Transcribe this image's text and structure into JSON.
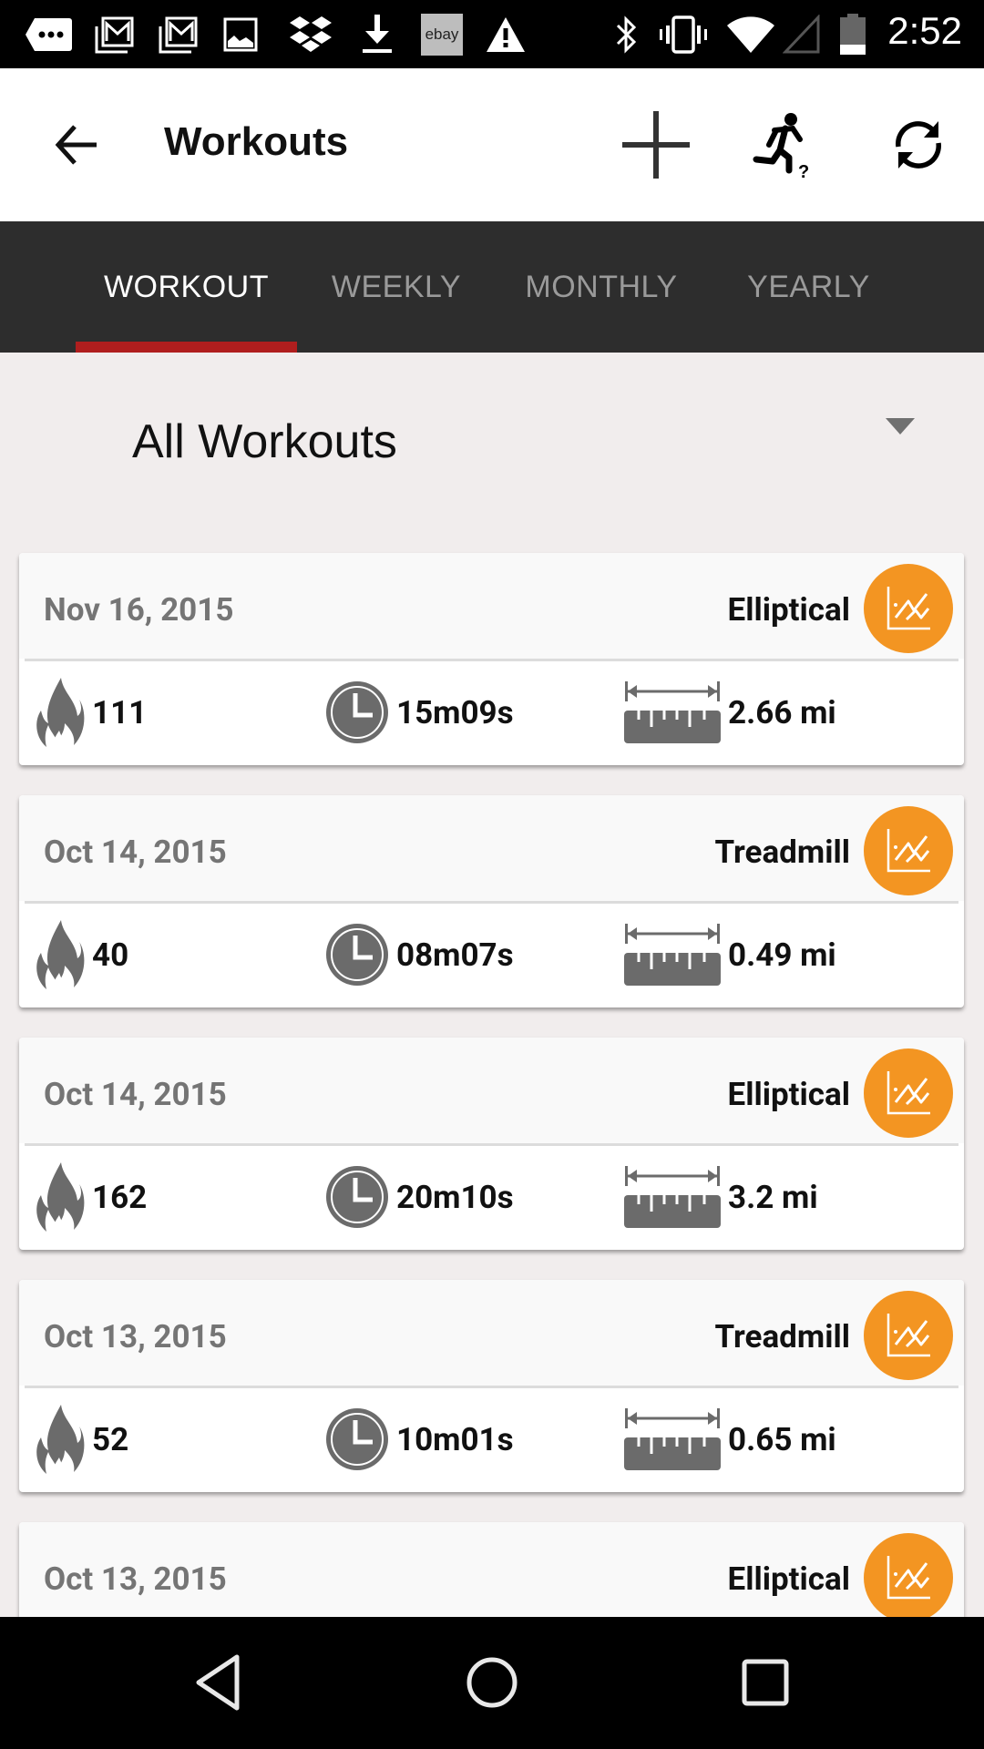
{
  "status_bar": {
    "time": "2:52",
    "notification_icons": [
      "more-notifications-icon",
      "gmail-icon",
      "gmail-icon",
      "image-icon",
      "dropbox-icon",
      "download-icon",
      "ebay-icon",
      "warning-icon"
    ],
    "ebay_label": "ebay",
    "system_icons": [
      "bluetooth-icon",
      "vibrate-icon",
      "wifi-icon",
      "cell-signal-icon",
      "battery-icon"
    ]
  },
  "app_bar": {
    "title": "Workouts",
    "actions": [
      "add-icon",
      "workout-help-icon",
      "sync-icon"
    ]
  },
  "tabs": [
    {
      "label": "WORKOUT",
      "active": true
    },
    {
      "label": "WEEKLY",
      "active": false
    },
    {
      "label": "MONTHLY",
      "active": false
    },
    {
      "label": "YEARLY",
      "active": false
    }
  ],
  "filter": {
    "selected": "All Workouts"
  },
  "colors": {
    "accent_orange": "#f39522",
    "tab_indicator": "#b01e1e",
    "tab_bar": "#2d2d2d",
    "icon_gray": "#6b6b6b"
  },
  "workouts": [
    {
      "date": "Nov 16, 2015",
      "type": "Elliptical",
      "calories": "111",
      "duration": "15m09s",
      "distance": "2.66 mi"
    },
    {
      "date": "Oct 14, 2015",
      "type": "Treadmill",
      "calories": "40",
      "duration": "08m07s",
      "distance": "0.49 mi"
    },
    {
      "date": "Oct 14, 2015",
      "type": "Elliptical",
      "calories": "162",
      "duration": "20m10s",
      "distance": "3.2 mi"
    },
    {
      "date": "Oct 13, 2015",
      "type": "Treadmill",
      "calories": "52",
      "duration": "10m01s",
      "distance": "0.65 mi"
    },
    {
      "date": "Oct 13, 2015",
      "type": "Elliptical",
      "calories": "",
      "duration": "",
      "distance": ""
    }
  ],
  "nav_bar": [
    "back-nav-icon",
    "home-nav-icon",
    "recents-nav-icon"
  ]
}
